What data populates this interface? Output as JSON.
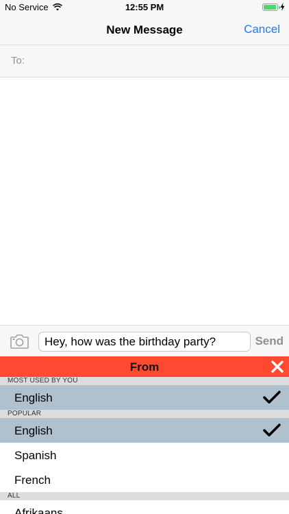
{
  "status_bar": {
    "carrier": "No Service",
    "time": "12:55 PM",
    "wifi_icon": "wifi-icon",
    "battery_icon": "battery-icon",
    "charging_icon": "bolt-icon"
  },
  "nav": {
    "title": "New Message",
    "cancel_label": "Cancel"
  },
  "to_field": {
    "label": "To:"
  },
  "compose": {
    "camera_icon": "camera-icon",
    "message_value": "Hey, how was the birthday party?",
    "send_label": "Send"
  },
  "translator": {
    "header_title": "From",
    "close_icon": "close-icon",
    "sections": {
      "most_used": {
        "title": "MOST USED BY YOU",
        "items": [
          {
            "label": "English",
            "selected": true
          }
        ]
      },
      "popular": {
        "title": "POPULAR",
        "items": [
          {
            "label": "English",
            "selected": true
          },
          {
            "label": "Spanish",
            "selected": false
          },
          {
            "label": "French",
            "selected": false
          }
        ]
      },
      "all": {
        "title": "ALL",
        "items": [
          {
            "label": "Afrikaans",
            "selected": false
          }
        ]
      }
    }
  },
  "colors": {
    "accent_blue": "#1a7cf5",
    "header_red": "#ff4a31",
    "selected_row": "#afc1cc",
    "battery_green": "#4cd964"
  }
}
